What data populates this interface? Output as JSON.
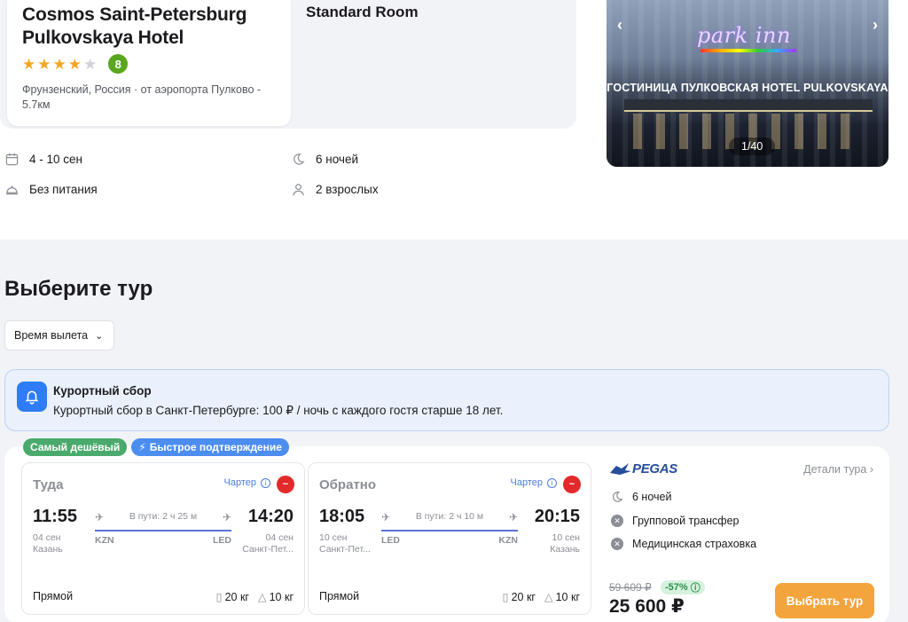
{
  "hotel": {
    "name_line1": "Cosmos Saint-Petersburg",
    "name_line2": "Pulkovskaya Hotel",
    "stars": 4,
    "stars_max": 5,
    "score": "8",
    "location_line1": "Фрунзенский, Россия · от аэропорта Пулково -",
    "location_line2": "5.7км",
    "room": "Standard Room"
  },
  "photo": {
    "logo_text": "park inn",
    "sign_text": "ГОСТИНИЦА ПУЛКОВСКАЯ HOTEL PULKOVSKAYA",
    "counter": "1/40",
    "prev": "‹",
    "next": "›"
  },
  "facts": {
    "dates": "4 - 10 сен",
    "nights": "6 ночей",
    "meal": "Без питания",
    "guests": "2 взрослых"
  },
  "section": {
    "title": "Выберите тур",
    "filter_label": "Время вылета"
  },
  "notice": {
    "title": "Курортный сбор",
    "text": "Курортный сбор в Санкт-Петербурге: 100 ₽ / ночь с каждого гостя старше 18 лет."
  },
  "badges": {
    "cheapest": "Самый дешёвый",
    "fast": "Быстрое подтверждение"
  },
  "outbound": {
    "title": "Туда",
    "charter": "Чартер",
    "dep_time": "11:55",
    "arr_time": "14:20",
    "dep_date": "04 сен",
    "dep_city": "Казань",
    "arr_date": "04 сен",
    "arr_city": "Санкт-Пет...",
    "duration": "В пути: 2 ч 25 м",
    "dep_code": "KZN",
    "arr_code": "LED",
    "direct": "Прямой",
    "bag1": "20 кг",
    "bag2": "10 кг"
  },
  "inbound": {
    "title": "Обратно",
    "charter": "Чартер",
    "dep_time": "18:05",
    "arr_time": "20:15",
    "dep_date": "10 сен",
    "dep_city": "Санкт-Пет...",
    "arr_date": "10 сен",
    "arr_city": "Казань",
    "duration": "В пути: 2 ч 10 м",
    "dep_code": "LED",
    "arr_code": "KZN",
    "direct": "Прямой",
    "bag1": "20 кг",
    "bag2": "10 кг"
  },
  "offer": {
    "operator": "PEGAS",
    "details_link": "Детали тура",
    "nights": "6 ночей",
    "transfer": "Групповой трансфер",
    "insurance": "Медицинская страховка",
    "old_price": "59 609 ₽",
    "discount": "-57%",
    "price": "25 600 ₽",
    "select_label": "Выбрать тур"
  },
  "colors": {
    "accent_orange": "#f4a43c",
    "score_green": "#5aa61e",
    "notice_blue": "#2f7df6",
    "badge_green": "#4aaa6d",
    "badge_blue": "#4c8df0"
  }
}
